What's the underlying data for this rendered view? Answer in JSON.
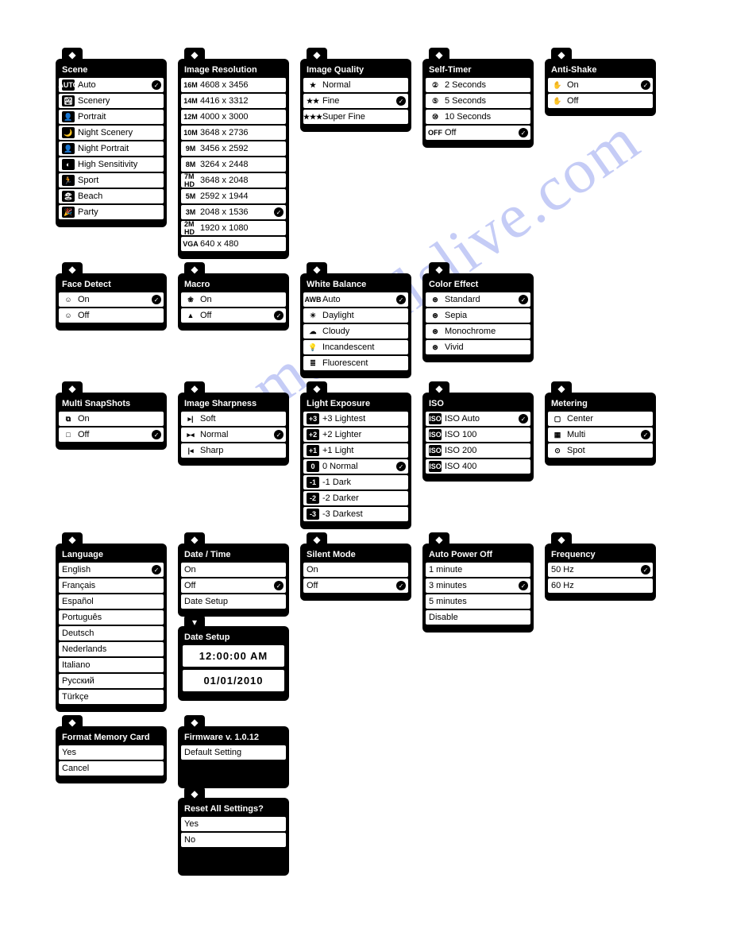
{
  "watermark": "manualslive.com",
  "panels": {
    "scene": {
      "title": "Scene",
      "items": [
        {
          "icon": "AUTO",
          "iconInv": true,
          "label": "Auto",
          "selected": true
        },
        {
          "icon": "🏞",
          "iconInv": true,
          "label": "Scenery"
        },
        {
          "icon": "👤",
          "iconInv": true,
          "label": "Portrait"
        },
        {
          "icon": "🌙",
          "iconInv": true,
          "label": "Night Scenery"
        },
        {
          "icon": "👤",
          "iconInv": true,
          "label": "Night Portrait"
        },
        {
          "icon": "◐",
          "iconInv": true,
          "label": "High Sensitivity"
        },
        {
          "icon": "🏃",
          "iconInv": true,
          "label": "Sport"
        },
        {
          "icon": "🏖",
          "iconInv": true,
          "label": "Beach"
        },
        {
          "icon": "🎉",
          "iconInv": true,
          "label": "Party"
        }
      ]
    },
    "imageResolution": {
      "title": "Image Resolution",
      "items": [
        {
          "icon": "16M",
          "label": "4608 x 3456"
        },
        {
          "icon": "14M",
          "label": "4416 x 3312"
        },
        {
          "icon": "12M",
          "label": "4000 x 3000"
        },
        {
          "icon": "10M",
          "label": "3648 x 2736"
        },
        {
          "icon": "9M",
          "label": "3456 x 2592"
        },
        {
          "icon": "8M",
          "label": "3264 x 2448"
        },
        {
          "icon": "7M HD",
          "label": "3648 x 2048"
        },
        {
          "icon": "5M",
          "label": "2592 x 1944"
        },
        {
          "icon": "3M",
          "label": "2048 x 1536",
          "selected": true
        },
        {
          "icon": "2M HD",
          "label": "1920 x 1080"
        },
        {
          "icon": "VGA",
          "label": "640 x 480"
        }
      ]
    },
    "imageQuality": {
      "title": "Image Quality",
      "items": [
        {
          "icon": "★",
          "label": "Normal"
        },
        {
          "icon": "★★",
          "label": "Fine",
          "selected": true
        },
        {
          "icon": "★★★",
          "label": "Super Fine"
        }
      ]
    },
    "selfTimer": {
      "title": "Self-Timer",
      "items": [
        {
          "icon": "②",
          "label": "2 Seconds"
        },
        {
          "icon": "⑤",
          "label": "5 Seconds"
        },
        {
          "icon": "⑩",
          "label": "10 Seconds"
        },
        {
          "icon": "OFF",
          "label": "Off",
          "selected": true
        }
      ]
    },
    "antiShake": {
      "title": "Anti-Shake",
      "items": [
        {
          "icon": "✋",
          "label": "On",
          "selected": true
        },
        {
          "icon": "✋",
          "label": "Off"
        }
      ]
    },
    "faceDetect": {
      "title": "Face Detect",
      "items": [
        {
          "icon": "☺",
          "label": "On",
          "selected": true
        },
        {
          "icon": "☺",
          "label": "Off"
        }
      ]
    },
    "macro": {
      "title": "Macro",
      "items": [
        {
          "icon": "❀",
          "label": "On"
        },
        {
          "icon": "▲",
          "label": "Off",
          "selected": true
        }
      ]
    },
    "whiteBalance": {
      "title": "White Balance",
      "items": [
        {
          "icon": "AWB",
          "label": "Auto",
          "selected": true
        },
        {
          "icon": "☀",
          "label": "Daylight"
        },
        {
          "icon": "☁",
          "label": "Cloudy"
        },
        {
          "icon": "💡",
          "label": "Incandescent"
        },
        {
          "icon": "≣",
          "label": "Fluorescent"
        }
      ]
    },
    "colorEffect": {
      "title": "Color Effect",
      "items": [
        {
          "icon": "⊛",
          "label": "Standard",
          "selected": true
        },
        {
          "icon": "⊛",
          "label": "Sepia"
        },
        {
          "icon": "⊛",
          "label": "Monochrome"
        },
        {
          "icon": "⊛",
          "label": "Vivid"
        }
      ]
    },
    "multiSnapshots": {
      "title": "Multi SnapShots",
      "items": [
        {
          "icon": "⧉",
          "label": "On"
        },
        {
          "icon": "□",
          "label": "Off",
          "selected": true
        }
      ]
    },
    "imageSharpness": {
      "title": "Image Sharpness",
      "items": [
        {
          "icon": "▸|",
          "label": "Soft"
        },
        {
          "icon": "▸◂",
          "label": "Normal",
          "selected": true
        },
        {
          "icon": "|◂",
          "label": "Sharp"
        }
      ]
    },
    "lightExposure": {
      "title": "Light Exposure",
      "items": [
        {
          "icon": "+3",
          "iconInv": true,
          "label": "+3 Lightest"
        },
        {
          "icon": "+2",
          "iconInv": true,
          "label": "+2 Lighter"
        },
        {
          "icon": "+1",
          "iconInv": true,
          "label": "+1 Light"
        },
        {
          "icon": "0",
          "iconInv": true,
          "label": "0 Normal",
          "selected": true
        },
        {
          "icon": "-1",
          "iconInv": true,
          "label": "-1 Dark"
        },
        {
          "icon": "-2",
          "iconInv": true,
          "label": "-2 Darker"
        },
        {
          "icon": "-3",
          "iconInv": true,
          "label": "-3 Darkest"
        }
      ]
    },
    "iso": {
      "title": "ISO",
      "items": [
        {
          "icon": "ISO",
          "iconInv": true,
          "label": "ISO Auto",
          "selected": true
        },
        {
          "icon": "ISO",
          "iconInv": true,
          "label": "ISO 100"
        },
        {
          "icon": "ISO",
          "iconInv": true,
          "label": "ISO 200"
        },
        {
          "icon": "ISO",
          "iconInv": true,
          "label": "ISO 400"
        }
      ]
    },
    "metering": {
      "title": "Metering",
      "items": [
        {
          "icon": "▢",
          "label": "Center"
        },
        {
          "icon": "▦",
          "label": "Multi",
          "selected": true
        },
        {
          "icon": "⊙",
          "label": "Spot"
        }
      ]
    },
    "language": {
      "title": "Language",
      "items": [
        {
          "label": "English",
          "selected": true
        },
        {
          "label": "Français"
        },
        {
          "label": "Español"
        },
        {
          "label": "Português"
        },
        {
          "label": "Deutsch"
        },
        {
          "label": "Nederlands"
        },
        {
          "label": "Italiano"
        },
        {
          "label": "Русский"
        },
        {
          "label": "Türkçe"
        }
      ]
    },
    "dateTime": {
      "title": "Date / Time",
      "items": [
        {
          "label": "On"
        },
        {
          "label": "Off",
          "selected": true
        },
        {
          "label": "Date Setup"
        }
      ]
    },
    "dateSetup": {
      "title": "Date Setup",
      "time": "12:00:00 AM",
      "date": "01/01/2010"
    },
    "silentMode": {
      "title": "Silent Mode",
      "items": [
        {
          "label": "On"
        },
        {
          "label": "Off",
          "selected": true
        }
      ]
    },
    "autoPowerOff": {
      "title": "Auto Power Off",
      "items": [
        {
          "label": "1 minute"
        },
        {
          "label": "3 minutes",
          "selected": true
        },
        {
          "label": "5 minutes"
        },
        {
          "label": "Disable"
        }
      ]
    },
    "frequency": {
      "title": "Frequency",
      "items": [
        {
          "label": "50 Hz",
          "selected": true
        },
        {
          "label": "60 Hz"
        }
      ]
    },
    "formatMemory": {
      "title": "Format Memory Card",
      "items": [
        {
          "label": "Yes"
        },
        {
          "label": "Cancel"
        }
      ]
    },
    "firmware": {
      "title": "Firmware v. 1.0.12",
      "items": [
        {
          "label": "Default Setting"
        }
      ]
    },
    "resetAll": {
      "title": "Reset All Settings?",
      "items": [
        {
          "label": "Yes"
        },
        {
          "label": "No"
        }
      ]
    }
  }
}
